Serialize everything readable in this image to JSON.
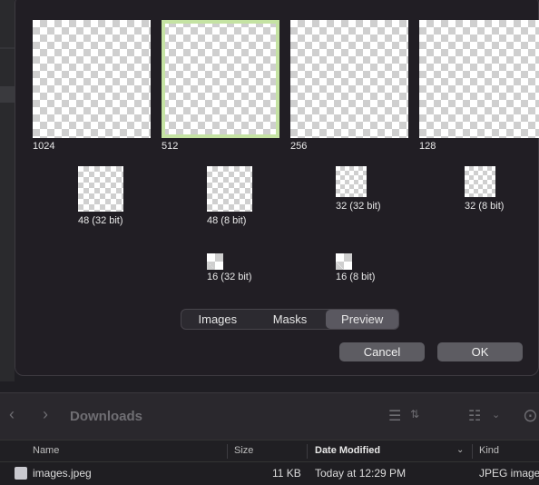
{
  "icons": [
    {
      "size_label": "1024"
    },
    {
      "size_label": "512"
    },
    {
      "size_label": "256"
    },
    {
      "size_label": "128"
    },
    {
      "size_label": "48 (32 bit)"
    },
    {
      "size_label": "48 (8 bit)"
    },
    {
      "size_label": "32 (32 bit)"
    },
    {
      "size_label": "32 (8 bit)"
    },
    {
      "size_label": "16 (32 bit)"
    },
    {
      "size_label": "16 (8 bit)"
    }
  ],
  "segmented": {
    "tabs": [
      "Images",
      "Masks",
      "Preview"
    ],
    "selected": "Preview"
  },
  "buttons": {
    "cancel": "Cancel",
    "ok": "OK"
  },
  "finder": {
    "folder_title": "Downloads",
    "columns": {
      "name": "Name",
      "size": "Size",
      "date_modified": "Date Modified",
      "kind": "Kind"
    },
    "files": [
      {
        "name": "images.jpeg",
        "size": "11 KB",
        "date": "Today at 12:29 PM",
        "kind": "JPEG image"
      }
    ]
  },
  "colors": {
    "selection_outline": "#c5e3a3",
    "segment_active": "#5a5860"
  }
}
